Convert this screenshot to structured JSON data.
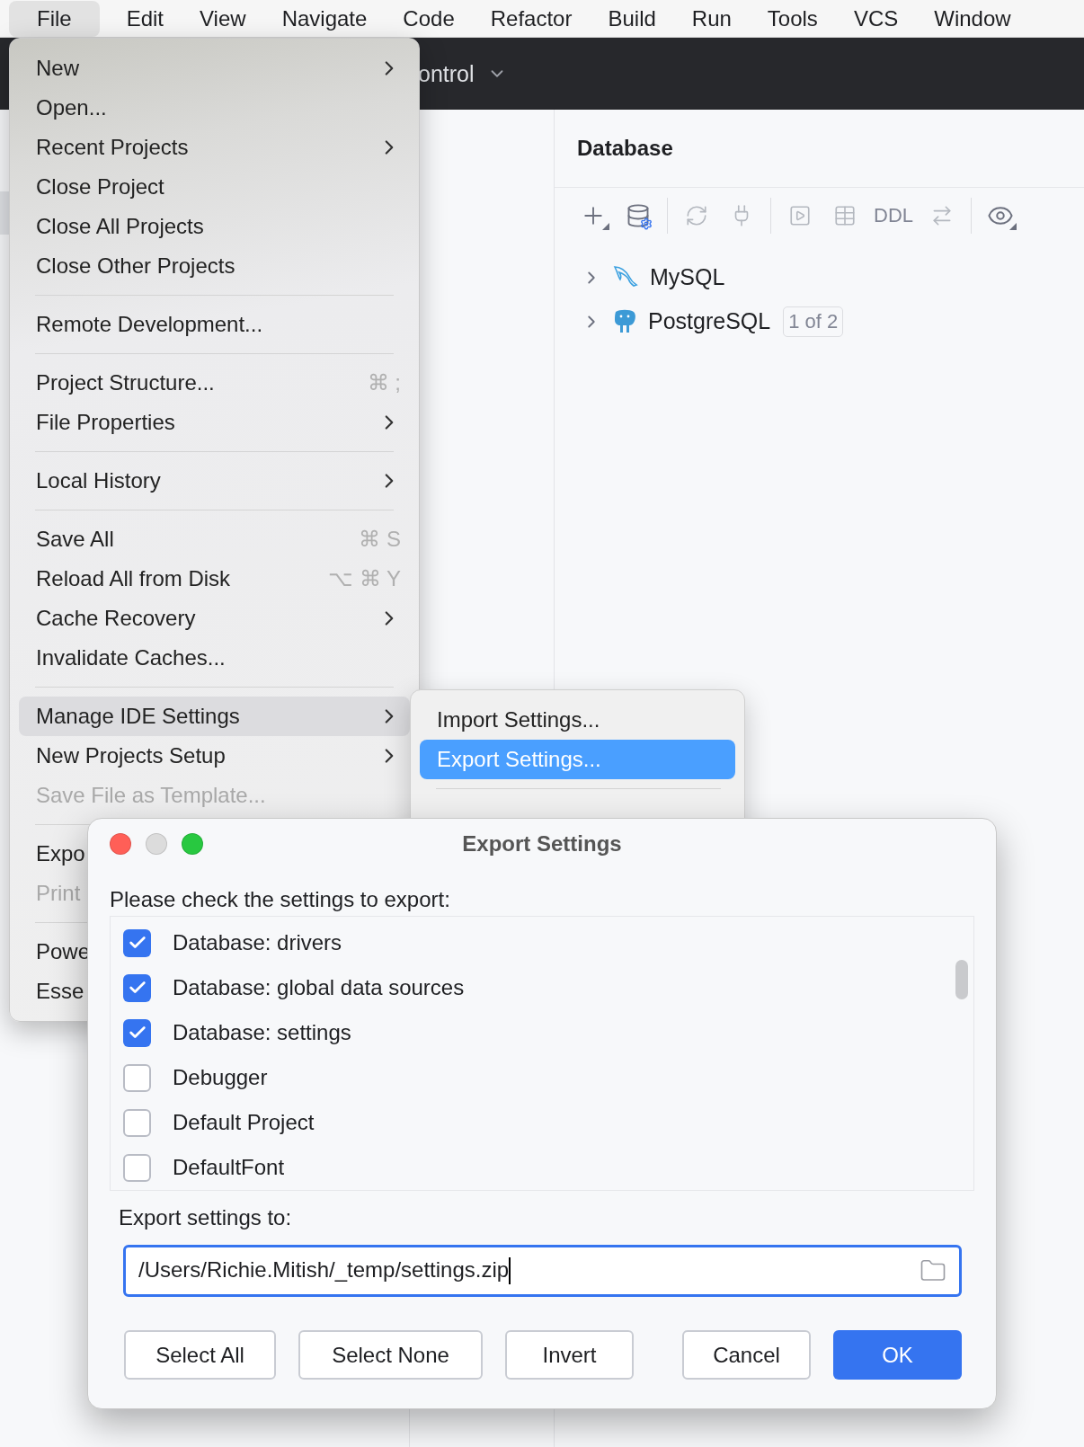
{
  "menubar": [
    {
      "label": "File",
      "selected": true
    },
    {
      "label": "Edit",
      "selected": false
    },
    {
      "label": "View",
      "selected": false
    },
    {
      "label": "Navigate",
      "selected": false
    },
    {
      "label": "Code",
      "selected": false
    },
    {
      "label": "Refactor",
      "selected": false
    },
    {
      "label": "Build",
      "selected": false
    },
    {
      "label": "Run",
      "selected": false
    },
    {
      "label": "Tools",
      "selected": false
    },
    {
      "label": "VCS",
      "selected": false
    },
    {
      "label": "Window",
      "selected": false
    }
  ],
  "header": {
    "project_switcher": "ontrol"
  },
  "database_panel": {
    "title": "Database",
    "ddl_label": "DDL",
    "tree": [
      {
        "label": "MySQL",
        "kind": "mysql",
        "expanded": false
      },
      {
        "label": "PostgreSQL",
        "kind": "postgresql",
        "expanded": false,
        "badge": "1 of 2"
      }
    ]
  },
  "file_menu": {
    "items": [
      {
        "kind": "item",
        "label": "New",
        "has_submenu": true,
        "selected": false,
        "disabled": false
      },
      {
        "kind": "item",
        "label": "Open...",
        "has_submenu": false,
        "selected": false,
        "disabled": false
      },
      {
        "kind": "item",
        "label": "Recent Projects",
        "has_submenu": true,
        "selected": false,
        "disabled": false
      },
      {
        "kind": "item",
        "label": "Close Project",
        "has_submenu": false,
        "selected": false,
        "disabled": false
      },
      {
        "kind": "item",
        "label": "Close All Projects",
        "has_submenu": false,
        "selected": false,
        "disabled": false
      },
      {
        "kind": "item",
        "label": "Close Other Projects",
        "has_submenu": false,
        "selected": false,
        "disabled": false
      },
      {
        "kind": "separator"
      },
      {
        "kind": "item",
        "label": "Remote Development...",
        "has_submenu": false,
        "selected": false,
        "disabled": false
      },
      {
        "kind": "separator"
      },
      {
        "kind": "item",
        "label": "Project Structure...",
        "shortcut": "⌘ ;",
        "has_submenu": false,
        "selected": false,
        "disabled": false
      },
      {
        "kind": "item",
        "label": "File Properties",
        "has_submenu": true,
        "selected": false,
        "disabled": false
      },
      {
        "kind": "separator"
      },
      {
        "kind": "item",
        "label": "Local History",
        "has_submenu": true,
        "selected": false,
        "disabled": false
      },
      {
        "kind": "separator"
      },
      {
        "kind": "item",
        "label": "Save All",
        "shortcut": "⌘ S",
        "has_submenu": false,
        "selected": false,
        "disabled": false
      },
      {
        "kind": "item",
        "label": "Reload All from Disk",
        "shortcut": "⌥ ⌘ Y",
        "has_submenu": false,
        "selected": false,
        "disabled": false
      },
      {
        "kind": "item",
        "label": "Cache Recovery",
        "has_submenu": true,
        "selected": false,
        "disabled": false
      },
      {
        "kind": "item",
        "label": "Invalidate Caches...",
        "has_submenu": false,
        "selected": false,
        "disabled": false
      },
      {
        "kind": "separator"
      },
      {
        "kind": "item",
        "label": "Manage IDE Settings",
        "has_submenu": true,
        "selected": true,
        "disabled": false
      },
      {
        "kind": "item",
        "label": "New Projects Setup",
        "has_submenu": true,
        "selected": false,
        "disabled": false
      },
      {
        "kind": "item",
        "label": "Save File as Template...",
        "has_submenu": false,
        "selected": false,
        "disabled": true
      },
      {
        "kind": "separator"
      },
      {
        "kind": "item",
        "label": "Expo",
        "has_submenu": false,
        "selected": false,
        "disabled": false
      },
      {
        "kind": "item",
        "label": "Print",
        "has_submenu": false,
        "selected": false,
        "disabled": true
      },
      {
        "kind": "separator"
      },
      {
        "kind": "item",
        "label": "Powe",
        "has_submenu": false,
        "selected": false,
        "disabled": false
      },
      {
        "kind": "item",
        "label": "Esse",
        "has_submenu": false,
        "selected": false,
        "disabled": false
      }
    ]
  },
  "settings_submenu": {
    "items": [
      {
        "kind": "item",
        "label": "Import Settings...",
        "selected": false
      },
      {
        "kind": "item",
        "label": "Export Settings...",
        "selected": true
      },
      {
        "kind": "separator"
      }
    ]
  },
  "dialog": {
    "title": "Export Settings",
    "prompt": "Please check the settings to export:",
    "settings": [
      {
        "label": "Database: drivers",
        "checked": true
      },
      {
        "label": "Database: global data sources",
        "checked": true
      },
      {
        "label": "Database: settings",
        "checked": true
      },
      {
        "label": "Debugger",
        "checked": false
      },
      {
        "label": "Default Project",
        "checked": false
      },
      {
        "label": "DefaultFont",
        "checked": false
      }
    ],
    "path_label": "Export settings to:",
    "path": "/Users/Richie.Mitish/_temp/settings.zip",
    "selection_buttons": [
      {
        "label": "Select All",
        "default": false
      },
      {
        "label": "Select None",
        "default": false
      },
      {
        "label": "Invert",
        "default": false
      }
    ],
    "buttons": [
      {
        "label": "Cancel",
        "default": false
      },
      {
        "label": "OK",
        "default": true
      }
    ]
  }
}
